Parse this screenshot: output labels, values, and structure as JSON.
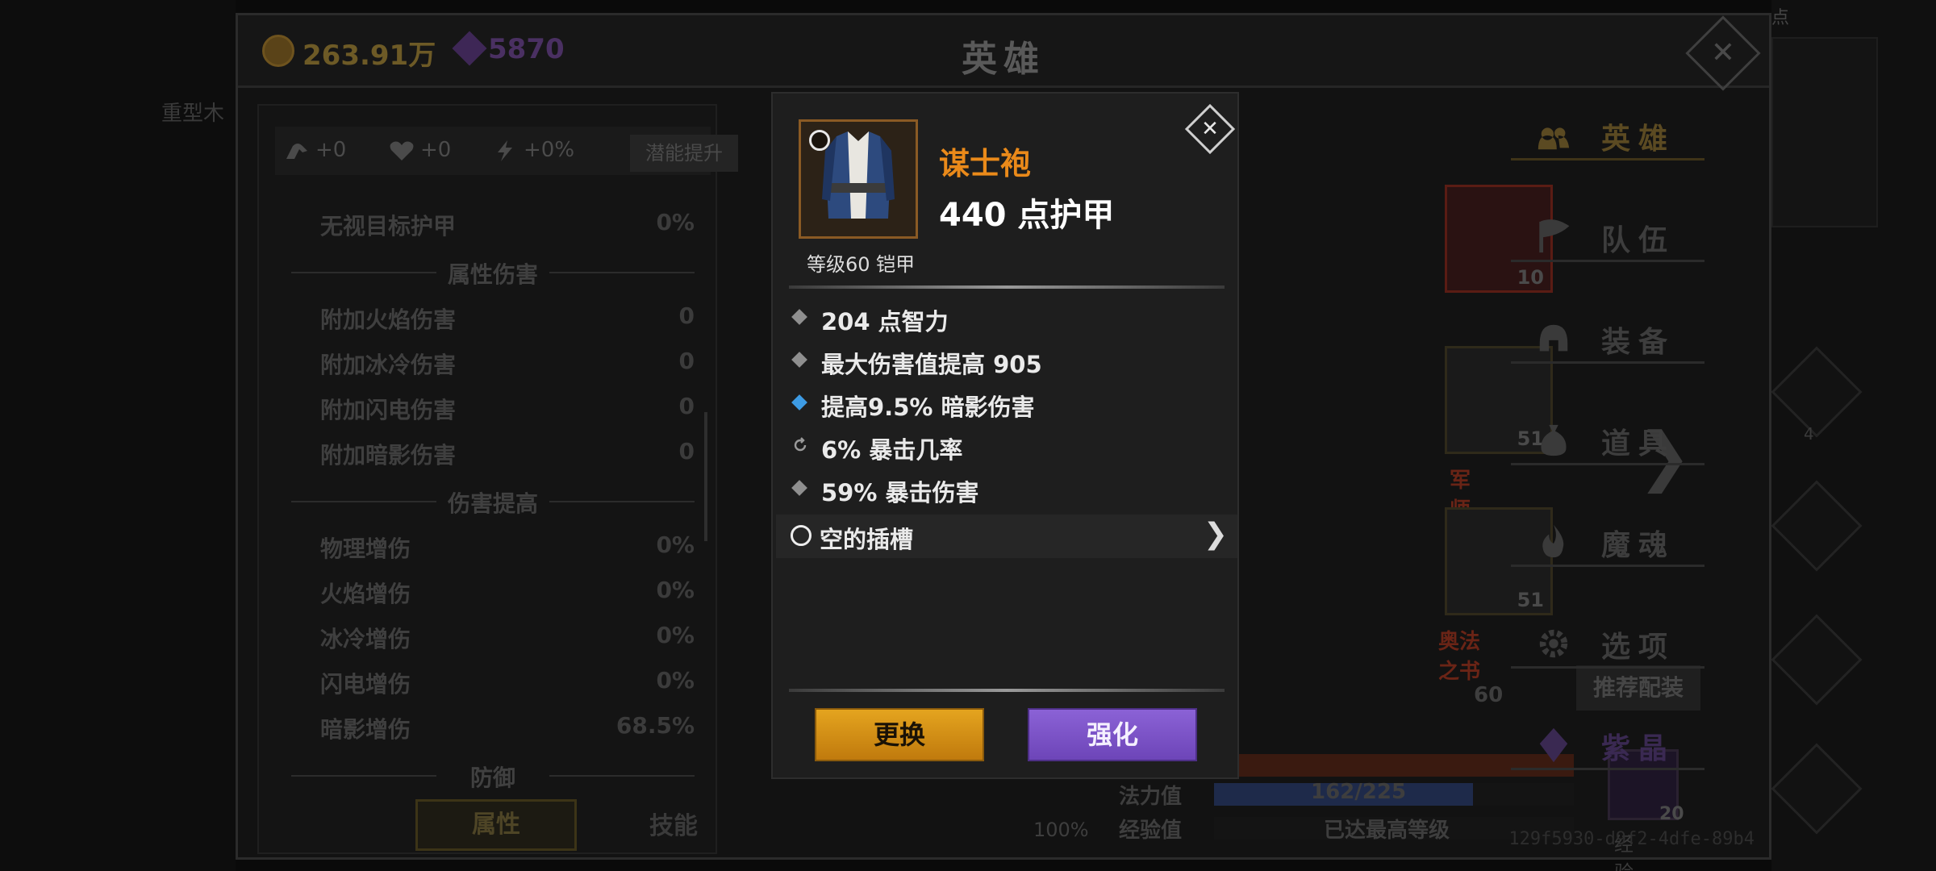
{
  "header": {
    "title": "英雄",
    "gold": "263.91万",
    "gems": "5870"
  },
  "background": {
    "left_text": "重型木",
    "right_top_text": "点",
    "side_badge": "4"
  },
  "stats_panel": {
    "bar": {
      "strength": "+0",
      "health": "+0",
      "energy": "+0%",
      "potential_button": "潜能提升"
    },
    "rows": [
      {
        "kind": "stat",
        "label": "无视目标护甲",
        "value": "0%"
      },
      {
        "kind": "section",
        "label": "属性伤害"
      },
      {
        "kind": "stat",
        "label": "附加火焰伤害",
        "value": "0"
      },
      {
        "kind": "stat",
        "label": "附加冰冷伤害",
        "value": "0"
      },
      {
        "kind": "stat",
        "label": "附加闪电伤害",
        "value": "0"
      },
      {
        "kind": "stat",
        "label": "附加暗影伤害",
        "value": "0"
      },
      {
        "kind": "section",
        "label": "伤害提高"
      },
      {
        "kind": "stat",
        "label": "物理增伤",
        "value": "0%"
      },
      {
        "kind": "stat",
        "label": "火焰增伤",
        "value": "0%"
      },
      {
        "kind": "stat",
        "label": "冰冷增伤",
        "value": "0%"
      },
      {
        "kind": "stat",
        "label": "闪电增伤",
        "value": "0%"
      },
      {
        "kind": "stat",
        "label": "暗影增伤",
        "value": "68.5%"
      },
      {
        "kind": "section",
        "label": "防御"
      }
    ],
    "tabs": {
      "attributes": "属性",
      "skills": "技能"
    }
  },
  "equipment_area": {
    "slot_top_count": "10",
    "boots_count": "51",
    "boots_label": "军师鞋",
    "book_count": "51",
    "book_label": "奥法之书",
    "recommend_button": "推荐配装",
    "partial_number": "60",
    "hp_percent": "100%",
    "mana_label": "法力值",
    "mana_value": "162/225",
    "mana_fraction": 0.72,
    "exp_label": "经验值",
    "exp_value": "已达最高等级",
    "exp_book_count": "20",
    "exp_book_label": "经验书"
  },
  "right_menu": {
    "items": [
      {
        "label": "英雄",
        "icon": "people-icon",
        "active": true
      },
      {
        "label": "队伍",
        "icon": "flag-icon"
      },
      {
        "label": "装备",
        "icon": "helmet-icon"
      },
      {
        "label": "道具",
        "icon": "bag-icon"
      },
      {
        "label": "魔魂",
        "icon": "flame-icon"
      },
      {
        "label": "选项",
        "icon": "gear-icon"
      },
      {
        "label": "紫晶",
        "icon": "crystal-icon",
        "gem": true
      }
    ],
    "uid": "129f5930-d9f2-4dfe-89b4"
  },
  "item_popup": {
    "name": "谋士袍",
    "armor": "440 点护甲",
    "level_type": "等级60 铠甲",
    "affixes": [
      {
        "text": "204 点智力",
        "bullet": "diamond-gray"
      },
      {
        "text": "最大伤害值提高 905",
        "bullet": "diamond-gray"
      },
      {
        "text": "提高9.5% 暗影伤害",
        "bullet": "diamond-blue"
      },
      {
        "text": "6% 暴击几率",
        "bullet": "refresh"
      },
      {
        "text": "59% 暴击伤害",
        "bullet": "diamond-gray"
      }
    ],
    "socket": "空的插槽",
    "replace_button": "更换",
    "enhance_button": "强化"
  },
  "colors": {
    "item_name": "#ea8a1a",
    "replace_button": "#e4a41f",
    "enhance_button": "#8b62d6",
    "blue_affix": "#3d9be4"
  }
}
